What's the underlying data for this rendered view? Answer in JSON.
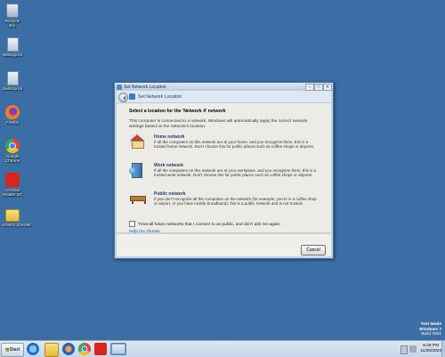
{
  "desktop": {
    "icons": [
      {
        "label": "Recycle Bin",
        "icon": "recycle-bin-icon"
      },
      {
        "label": "desktop.ini",
        "icon": "settings-file-icon"
      },
      {
        "label": "desktop.ini",
        "icon": "settings-file-icon"
      },
      {
        "label": "Firefox",
        "icon": "firefox-icon"
      },
      {
        "label": "Google Chrome",
        "icon": "chrome-icon"
      },
      {
        "label": "Acrobat Reader DC",
        "icon": "acrobat-icon"
      },
      {
        "label": "ADMIN_Elevate",
        "icon": "folder-icon"
      }
    ]
  },
  "watermark": {
    "line1": "Test Mode",
    "line2": "Windows 7",
    "line3": "Build 7601"
  },
  "dialog": {
    "window_title": "Set Network Location",
    "nav_title": "Set Network Location",
    "heading": "Select a location for the 'Network 4' network",
    "description": "This computer is connected to a network. Windows will automatically apply the correct network settings based on the network's location.",
    "options": [
      {
        "title": "Home network",
        "desc": "If all the computers on this network are at your home, and you recognize them, this is a trusted home network. Don't choose this for public places such as coffee shops or airports."
      },
      {
        "title": "Work network",
        "desc": "If all the computers on this network are at your workplace, and you recognize them, this is a trusted work network. Don't choose this for public places such as coffee shops or airports."
      },
      {
        "title": "Public network",
        "desc": "If you don't recognize all the computers on the network (for example, you're in a coffee shop or airport, or you have mobile broadband), this is a public network and is not trusted."
      }
    ],
    "checkbox_label": "Treat all future networks that I connect to as public, and don't ask me again.",
    "checkbox_checked": false,
    "help_link": "Help me choose",
    "cancel_label": "Cancel",
    "close_glyph": "✕",
    "max_glyph": "□",
    "min_glyph": "–"
  },
  "taskbar": {
    "start_label": "Start",
    "clock_time": "8:28 PM",
    "clock_date": "11/30/2023"
  }
}
